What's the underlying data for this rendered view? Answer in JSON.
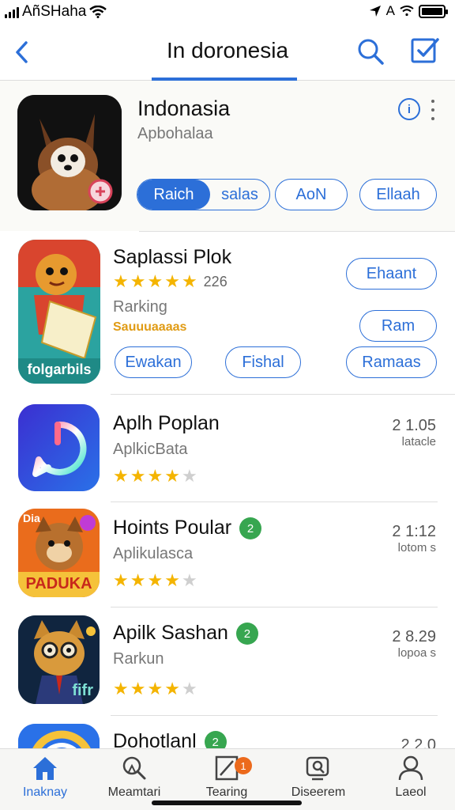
{
  "status_bar": {
    "carrier": "AñSHaha",
    "time": "",
    "right_text": "A"
  },
  "nav": {
    "title": "In doronesia",
    "back_icon": "chevron-left-icon",
    "search_icon": "search-icon",
    "compose_icon": "compose-icon"
  },
  "featured": {
    "name": "Indonasia",
    "subtitle": "Apbohalaa",
    "info_label": "i",
    "segment": {
      "active": "Raich",
      "inactive": "salas"
    },
    "buttons": [
      "AoN",
      "Ellaah"
    ]
  },
  "promo": {
    "name": "Saplassi Plok",
    "rating_count": "226",
    "subtitle": "Rarking",
    "tagline": "Sauuuaaaas",
    "icon_label": "folgarbils",
    "buttons": [
      "Ehaant",
      "Ram",
      "Ewakan",
      "Fishal",
      "Ramaas"
    ]
  },
  "apps": [
    {
      "name": "Aplh Poplan",
      "subtitle": "AplkicBata",
      "time": "2 1.05",
      "time_sub": "latacle",
      "rating": 4,
      "verified": false,
      "verified_label": ""
    },
    {
      "name": "Hoints Poular",
      "subtitle": "Aplikulasca",
      "time": "2 1:12",
      "time_sub": "lotom s",
      "rating": 4,
      "verified": true,
      "verified_label": "2",
      "icon_label": "PADUKA",
      "icon_tag": "Dia"
    },
    {
      "name": "Apilk Sashan",
      "subtitle": "Rarkun",
      "time": "2 8.29",
      "time_sub": "lopoa s",
      "rating": 4,
      "verified": true,
      "verified_label": "2",
      "icon_tag": "fifr"
    },
    {
      "name": "Dohotlanl",
      "subtitle": "",
      "time": "2 2.0",
      "time_sub": "",
      "rating": 0,
      "verified": true,
      "verified_label": "2"
    }
  ],
  "tabs": [
    {
      "label": "Inaknay",
      "icon": "home-icon",
      "active": true
    },
    {
      "label": "Meamtari",
      "icon": "explore-icon",
      "active": false
    },
    {
      "label": "Tearing",
      "icon": "edit-icon",
      "active": false,
      "badge": "1"
    },
    {
      "label": "Diseerem",
      "icon": "discover-icon",
      "active": false
    },
    {
      "label": "Laeol",
      "icon": "profile-icon",
      "active": false
    }
  ],
  "colors": {
    "accent": "#2c6fd8",
    "star": "#f4b400",
    "verified": "#37a650",
    "badge": "#ec6a1c"
  }
}
